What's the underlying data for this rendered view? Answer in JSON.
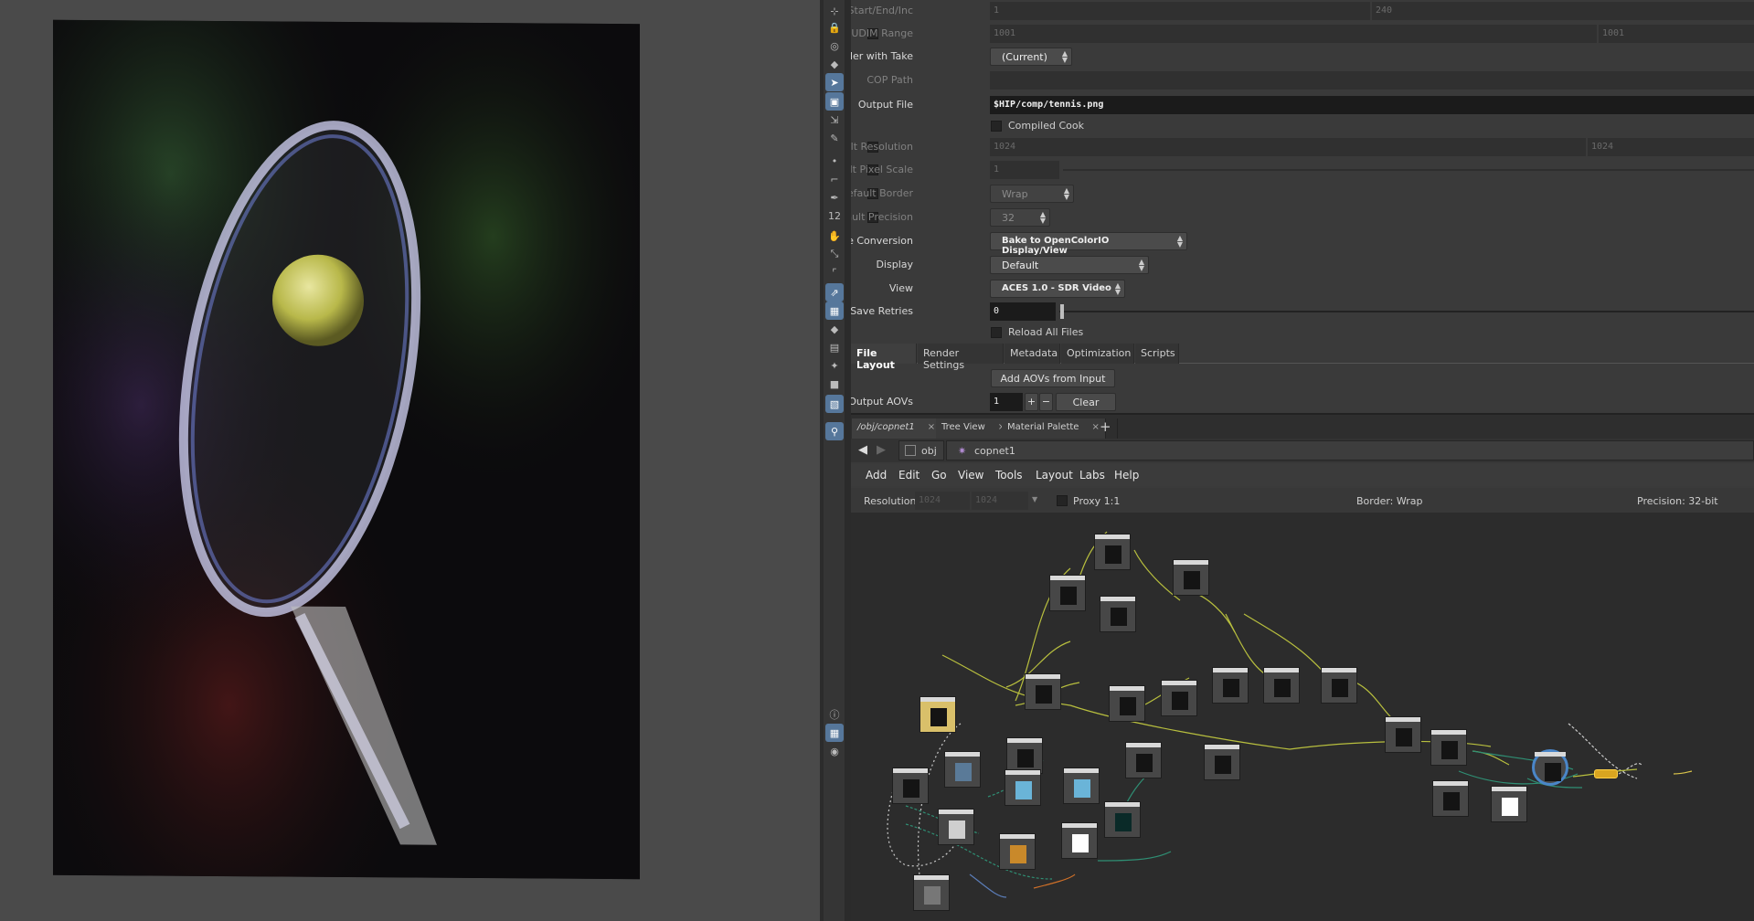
{
  "params": {
    "start_end_inc": {
      "label": "Start/End/Inc",
      "v1": "1",
      "v2": "240"
    },
    "udim_range": {
      "label": "UDIM Range",
      "v1": "1001",
      "v2": "1001"
    },
    "render_with_take": {
      "label": "Render with Take",
      "value": "(Current)"
    },
    "cop_path": {
      "label": "COP Path",
      "value": ""
    },
    "output_file": {
      "label": "Output File",
      "value": "$HIP/comp/tennis.png"
    },
    "compiled_cook": {
      "label": "Compiled Cook"
    },
    "default_resolution": {
      "label": "Default Resolution",
      "v1": "1024",
      "v2": "1024"
    },
    "default_pixel_scale": {
      "label": "Default Pixel Scale",
      "value": "1"
    },
    "default_border": {
      "label": "Default Border",
      "value": "Wrap"
    },
    "default_precision": {
      "label": "Default Precision",
      "value": "32"
    },
    "colorspace_conversion": {
      "label": "Colorspace Conversion",
      "value": "Bake to OpenColorIO Display/View"
    },
    "display": {
      "label": "Display",
      "value": "Default"
    },
    "view": {
      "label": "View",
      "value": "ACES 1.0 - SDR Video"
    },
    "save_retries": {
      "label": "Save Retries",
      "value": "0"
    },
    "reload_all_files": {
      "label": "Reload All Files"
    }
  },
  "tabs": [
    "File Layout",
    "Render Settings",
    "Metadata",
    "Optimization",
    "Scripts"
  ],
  "add_aovs_label": "Add AOVs from Input",
  "output_aovs": {
    "label": "Output AOVs",
    "value": "1",
    "plus": "+",
    "minus": "−",
    "clear": "Clear"
  },
  "pane_tabs": [
    {
      "label": "/obj/copnet1",
      "close": "×"
    },
    {
      "label": "Tree View",
      "close": "×"
    },
    {
      "label": "Material Palette",
      "close": "×"
    }
  ],
  "add_tab": "+",
  "path": {
    "root": "obj",
    "node": "copnet1"
  },
  "menu": [
    "Add",
    "Edit",
    "Go",
    "View",
    "Tools",
    "Layout",
    "Labs",
    "Help"
  ],
  "info": {
    "resolution_label": "Resolution",
    "res_x": "1024",
    "res_y": "1024",
    "proxy": "Proxy 1:1",
    "border": "Border: Wrap",
    "precision": "Precision: 32-bit"
  },
  "toolbar_icons": [
    "pose-icon",
    "lock-icon",
    "camera-orbit-icon",
    "snap-icon",
    "select-icon",
    "view-icon",
    "handle-icon",
    "paint-icon",
    "point-icon",
    "brush-icon",
    "pen-icon",
    "number-icon",
    "hand-icon",
    "scale-icon",
    "crop-icon",
    "transform-icon",
    "mask-icon",
    "diamond-icon",
    "image-icon",
    "wand-icon",
    "stop-icon",
    "screenshot-icon",
    "pin-icon",
    "info-icon",
    "layout-icon",
    "eye-icon"
  ]
}
